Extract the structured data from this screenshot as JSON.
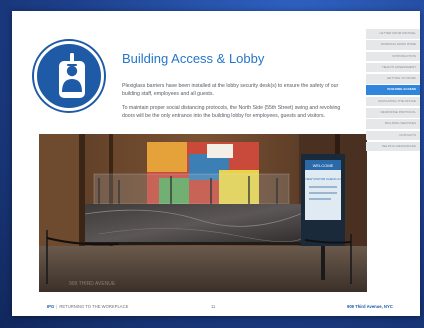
{
  "heading": "Building Access & Lobby",
  "paragraphs": [
    "Plexiglass barriers have been installed at the lobby security desk(s) to ensure the safety of our building staff, employees and all guests.",
    "To maintain proper social distancing protocols, the North Side (55th Street) swing and revolving doors will be the only entrance into the building lobby for employees, guests and visitors."
  ],
  "nav": {
    "items": [
      "LETTER FROM MICHAEL",
      "WORKING FROM HOME",
      "INTRODUCTION",
      "HEALTH ASSESSMENT",
      "GETTING TO WORK",
      "BUILDING ACCESS",
      "NAVIGATING THE OFFICE",
      "RESPONSE PROTOCOL",
      "BUILDING SERVICES",
      "CONTACTS",
      "HELPFUL RESOURCES"
    ],
    "active_index": 5
  },
  "photo": {
    "sign_heading": "WELCOME",
    "sign_subtitle": "NEW VISITOR CHECK-IN",
    "floor_text": "909 THIRD AVENUE"
  },
  "footer": {
    "brand": "IPG",
    "separator": "|",
    "section": "RETURNING TO THE WORKPLACE",
    "page_number": "11",
    "address": "909 Third Avenue, NYC"
  },
  "colors": {
    "accent": "#2576c9",
    "badge": "#1f5aa6",
    "nav_active": "#2f86dc",
    "nav_idle": "#e6e7e9"
  },
  "icons": {
    "badge": "employee-badge-icon"
  }
}
